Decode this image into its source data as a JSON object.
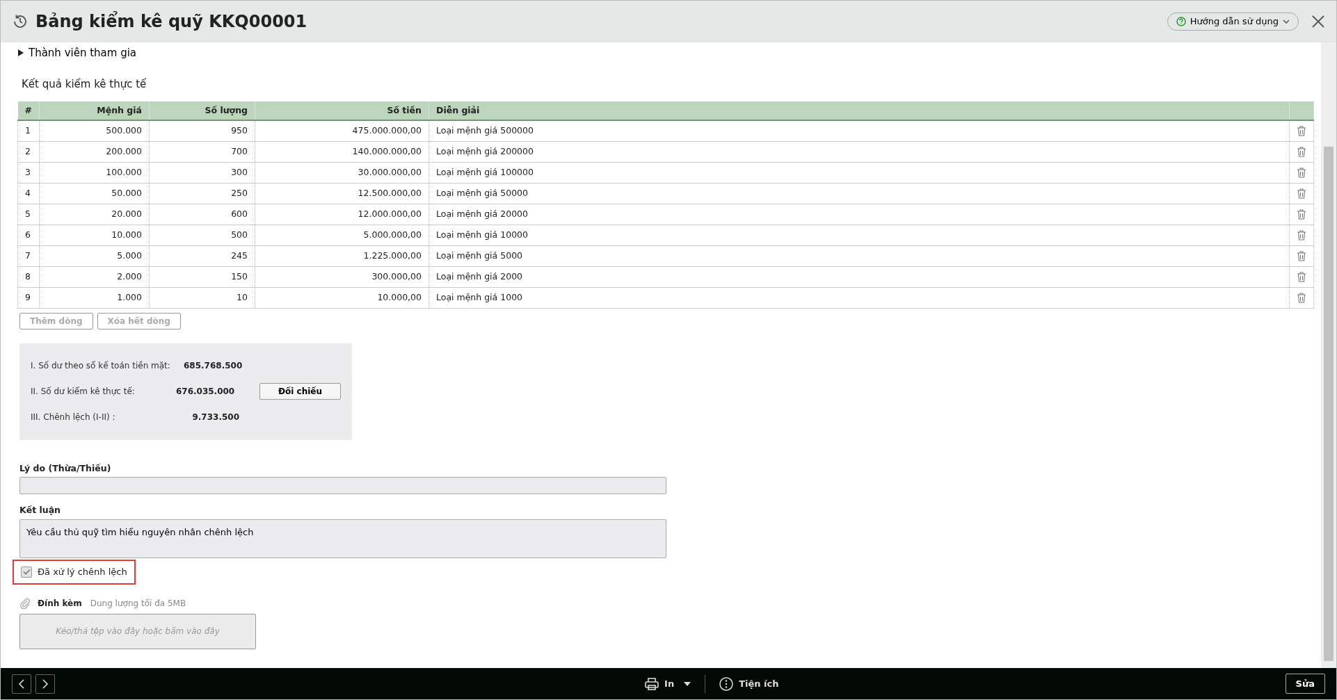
{
  "window": {
    "title": "Bảng kiểm kê quỹ KKQ00001",
    "help_button": "Hướng dẫn sử dụng"
  },
  "members_section": {
    "label": "Thành viên tham gia",
    "expanded": false
  },
  "results": {
    "title": "Kết quả kiểm kê thực tế",
    "table": {
      "columns": [
        "#",
        "Mệnh giá",
        "Số lượng",
        "Số tiền",
        "Diễn giải"
      ],
      "rows": [
        [
          "1",
          "500.000",
          "950",
          "475.000.000,00",
          "Loại mệnh giá 500000"
        ],
        [
          "2",
          "200.000",
          "700",
          "140.000.000,00",
          "Loại mệnh giá 200000"
        ],
        [
          "3",
          "100.000",
          "300",
          "30.000.000,00",
          "Loại mệnh giá 100000"
        ],
        [
          "4",
          "50.000",
          "250",
          "12.500.000,00",
          "Loại mệnh giá 50000"
        ],
        [
          "5",
          "20.000",
          "600",
          "12.000.000,00",
          "Loại mệnh giá 20000"
        ],
        [
          "6",
          "10.000",
          "500",
          "5.000.000,00",
          "Loại mệnh giá 10000"
        ],
        [
          "7",
          "5.000",
          "245",
          "1.225.000,00",
          "Loại mệnh giá 5000"
        ],
        [
          "8",
          "2.000",
          "150",
          "300.000,00",
          "Loại mệnh giá 2000"
        ],
        [
          "9",
          "1.000",
          "10",
          "10.000,00",
          "Loại mệnh giá 1000"
        ]
      ]
    },
    "buttons": [
      {
        "label": "Thêm dòng",
        "disabled": true
      },
      {
        "label": "Xóa hết dòng",
        "disabled": true
      }
    ]
  },
  "summary": {
    "lines": [
      {
        "label": "I. Số dư theo sổ kế toán tiền mặt:",
        "value": "685.768.500"
      },
      {
        "label": "II. Số dư kiểm kê thực tế:",
        "value": "676.035.000",
        "button": "Đối chiếu"
      },
      {
        "label": "III. Chênh lệch (I-II) :",
        "value": "9.733.500"
      }
    ]
  },
  "reason": {
    "label": "Lý do (Thừa/Thiếu)"
  },
  "conclusion": {
    "label": "Kết luận",
    "value": "Yêu cầu thủ quỹ tìm hiểu nguyên nhân chênh lệch"
  },
  "handled": {
    "label": "Đã xử lý chênh lệch",
    "checked": true,
    "highlighted": true
  },
  "attachment": {
    "label": "Đính kèm",
    "hint": "Dung lượng tối đa 5MB",
    "dropzone": "Kéo/thả tệp vào đây hoặc bấm vào đây"
  },
  "footer": {
    "print": "In",
    "utilities": "Tiện ích",
    "edit": "Sửa"
  }
}
